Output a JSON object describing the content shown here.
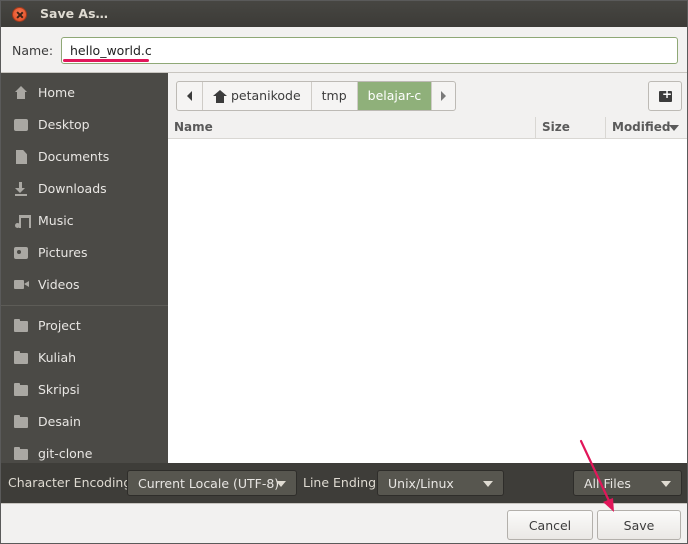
{
  "window": {
    "title": "Save As…",
    "close_icon": "close-icon"
  },
  "name_row": {
    "label": "Name:",
    "value": "hello_world.c"
  },
  "sidebar": {
    "items": [
      {
        "label": "Home",
        "icon": "home-icon"
      },
      {
        "label": "Desktop",
        "icon": "desktop-icon"
      },
      {
        "label": "Documents",
        "icon": "document-icon"
      },
      {
        "label": "Downloads",
        "icon": "download-icon"
      },
      {
        "label": "Music",
        "icon": "music-icon"
      },
      {
        "label": "Pictures",
        "icon": "picture-icon"
      },
      {
        "label": "Videos",
        "icon": "video-icon"
      },
      {
        "label": "Project",
        "icon": "folder-icon"
      },
      {
        "label": "Kuliah",
        "icon": "folder-icon"
      },
      {
        "label": "Skripsi",
        "icon": "folder-icon"
      },
      {
        "label": "Desain",
        "icon": "folder-icon"
      },
      {
        "label": "git-clone",
        "icon": "folder-icon"
      }
    ]
  },
  "pathbar": {
    "crumbs": [
      "petanikode",
      "tmp",
      "belajar-c"
    ],
    "active_index": 2
  },
  "file_list": {
    "columns": [
      "Name",
      "Size",
      "Modified"
    ],
    "sort_column": "Modified",
    "rows": []
  },
  "options": {
    "encoding_label": "Character Encoding:",
    "encoding_value": "Current Locale (UTF-8)",
    "line_ending_label": "Line Ending:",
    "line_ending_value": "Unix/Linux",
    "filter_value": "All Files"
  },
  "buttons": {
    "cancel": "Cancel",
    "save": "Save"
  },
  "colors": {
    "accent_green": "#8fb07a",
    "annotation_pink": "#e1165a",
    "sidebar_bg": "#4b4a46",
    "titlebar_bg": "#3c3b37"
  }
}
